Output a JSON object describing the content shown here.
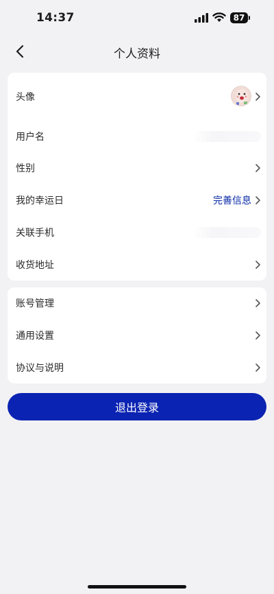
{
  "status_bar": {
    "time": "14:37",
    "battery": "87"
  },
  "nav": {
    "title": "个人资料"
  },
  "profile_rows": [
    {
      "label": "头像"
    },
    {
      "label": "用户名"
    },
    {
      "label": "性别"
    },
    {
      "label": "我的幸运日",
      "value": "完善信息"
    },
    {
      "label": "关联手机"
    },
    {
      "label": "收货地址"
    }
  ],
  "settings_rows": [
    {
      "label": "账号管理"
    },
    {
      "label": "通用设置"
    },
    {
      "label": "协议与说明"
    }
  ],
  "logout": {
    "label": "退出登录"
  },
  "colors": {
    "accent": "#0a23b2",
    "link": "#0a2aa8",
    "background": "#f2f2f4"
  },
  "icons": [
    "back-chevron-icon",
    "chevron-right-icon",
    "signal-icon",
    "wifi-icon",
    "battery-icon"
  ]
}
